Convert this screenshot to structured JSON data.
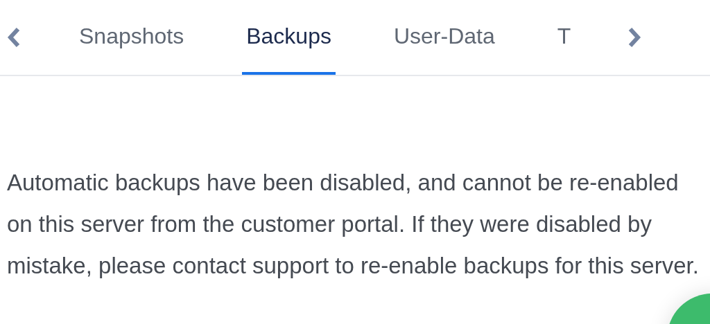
{
  "tabs": [
    {
      "label": "Snapshots",
      "selected": false
    },
    {
      "label": "Backups",
      "selected": true
    },
    {
      "label": "User-Data",
      "selected": false
    },
    {
      "label": "T",
      "selected": false
    }
  ],
  "message": "Automatic backups have been disabled, and cannot be re-enabled on this server from the customer portal. If they were disabled by mistake, please contact support to re-enable backups for this server."
}
